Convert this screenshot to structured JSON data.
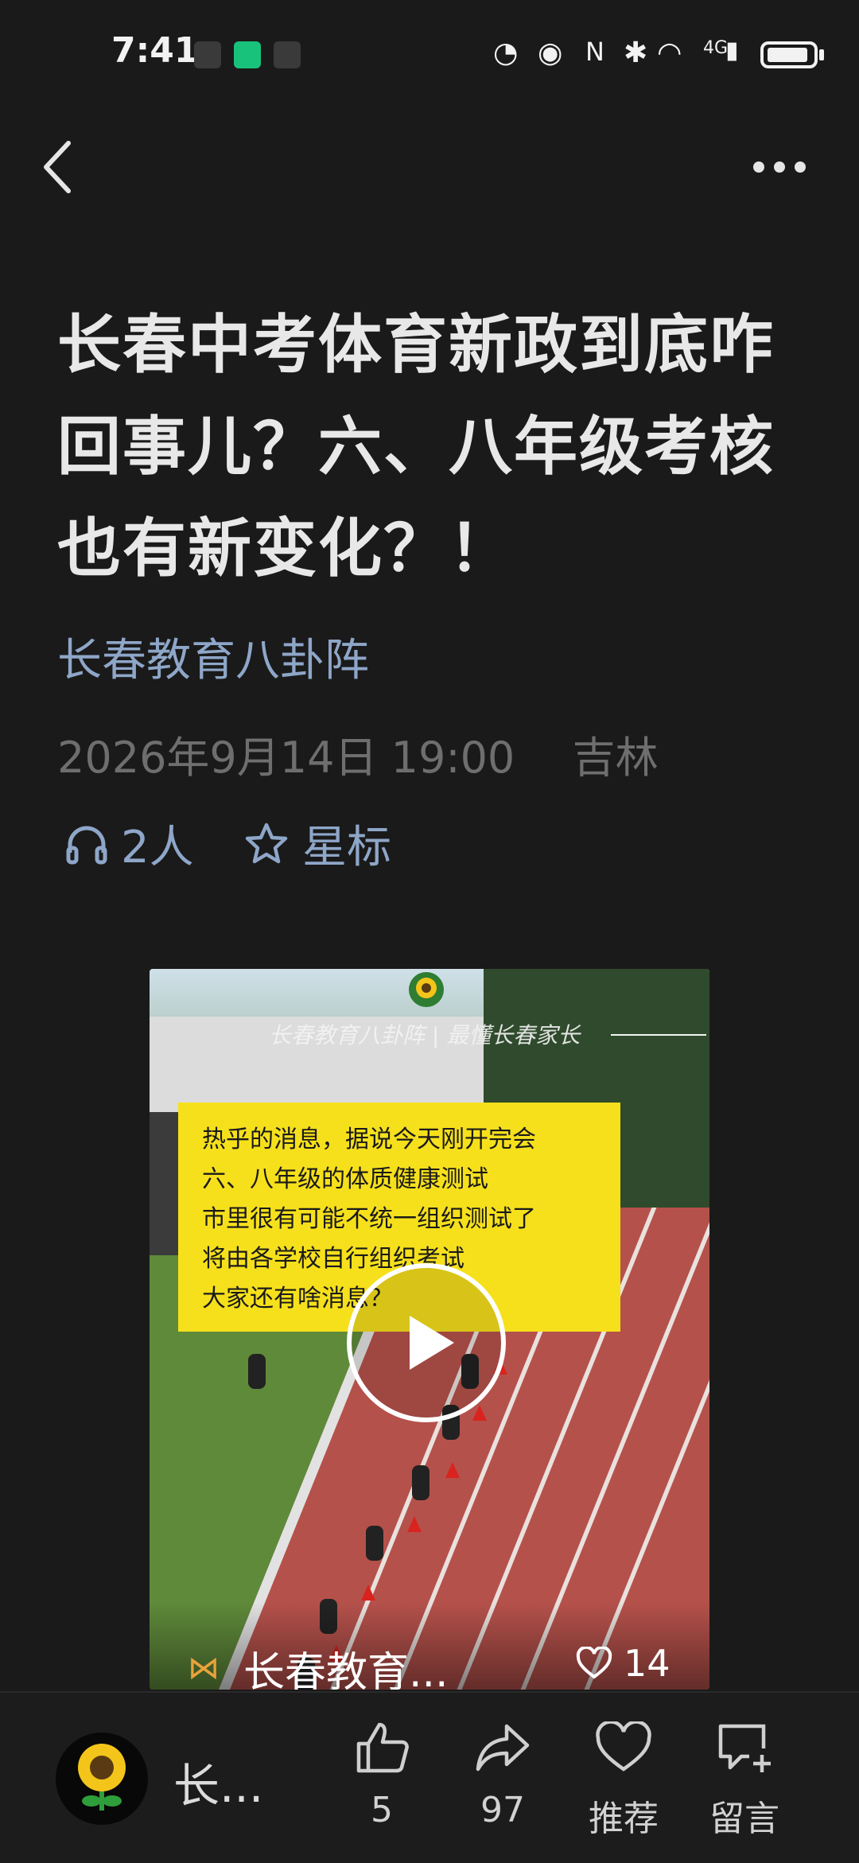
{
  "status_bar": {
    "time": "7:41",
    "network": "4G"
  },
  "article": {
    "title": "长春中考体育新政到底咋回事儿？六、八年级考核也有新变化？！",
    "author": "长春教育八卦阵",
    "date": "2026年9月14日 19:00",
    "location": "吉林",
    "listeners": "2人",
    "star_label": "星标"
  },
  "video": {
    "watermark": "长春教育八卦阵 | 最懂长春家长",
    "text_lines": [
      "热乎的消息，据说今天刚开完会",
      "六、八年级的体质健康测试",
      "市里很有可能不统一组织测试了",
      "将由各学校自行组织考试",
      "大家还有啥消息？"
    ],
    "channel": "长春教育...",
    "likes": "14"
  },
  "bottom": {
    "account": "长...",
    "like_count": "5",
    "share_count": "97",
    "recommend_label": "推荐",
    "comment_label": "留言"
  },
  "colors": {
    "background": "#1a1a1a",
    "link": "#8ea6c8",
    "meta": "#6e6e6e",
    "highlight": "#f6e01c"
  }
}
